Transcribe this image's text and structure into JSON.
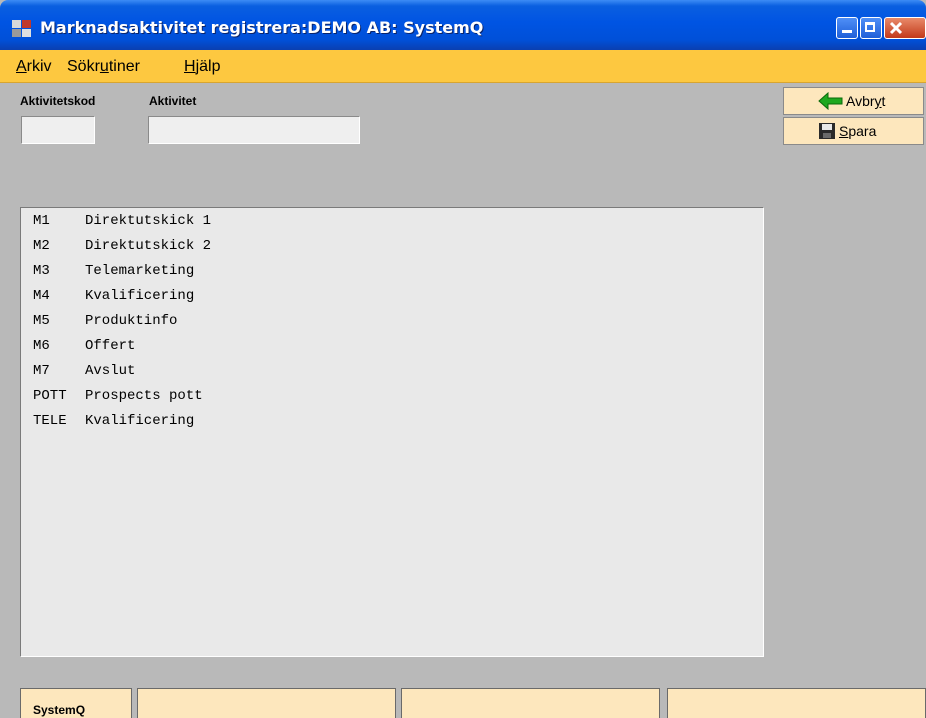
{
  "window": {
    "title": "Marknadsaktivitet registrera:DEMO AB: SystemQ",
    "controls": {
      "minimize": "minimize-icon",
      "maximize": "maximize-icon",
      "close": "close-icon"
    }
  },
  "menu": [
    {
      "label": "Arkiv",
      "mnemonic": "A"
    },
    {
      "label": "Sökrutiner",
      "mnemonic": "u"
    },
    {
      "label": "Hjälp",
      "mnemonic": "H"
    }
  ],
  "form": {
    "code_label": "Aktivitetskod",
    "code_value": "",
    "activity_label": "Aktivitet",
    "activity_value": ""
  },
  "actions": {
    "cancel_label": "Avbryt",
    "cancel_icon": "back-arrow-icon",
    "save_label": "Spara",
    "save_icon": "floppy-disk-icon"
  },
  "list": {
    "items": [
      {
        "code": "M1",
        "name": "Direktutskick 1"
      },
      {
        "code": "M2",
        "name": "Direktutskick 2"
      },
      {
        "code": "M3",
        "name": "Telemarketing"
      },
      {
        "code": "M4",
        "name": "Kvalificering"
      },
      {
        "code": "M5",
        "name": "Produktinfo"
      },
      {
        "code": "M6",
        "name": "Offert"
      },
      {
        "code": "M7",
        "name": "Avslut"
      },
      {
        "code": "POTT",
        "name": "Prospects pott"
      },
      {
        "code": "TELE",
        "name": "Kvalificering"
      }
    ]
  },
  "statusbar": {
    "cells": [
      "SystemQ",
      "",
      "",
      ""
    ]
  },
  "colors": {
    "menubar": "#fdc840",
    "button_bg": "#fde7bd",
    "window_bg": "#b9b9b9",
    "titlebar": "#0054e3"
  }
}
